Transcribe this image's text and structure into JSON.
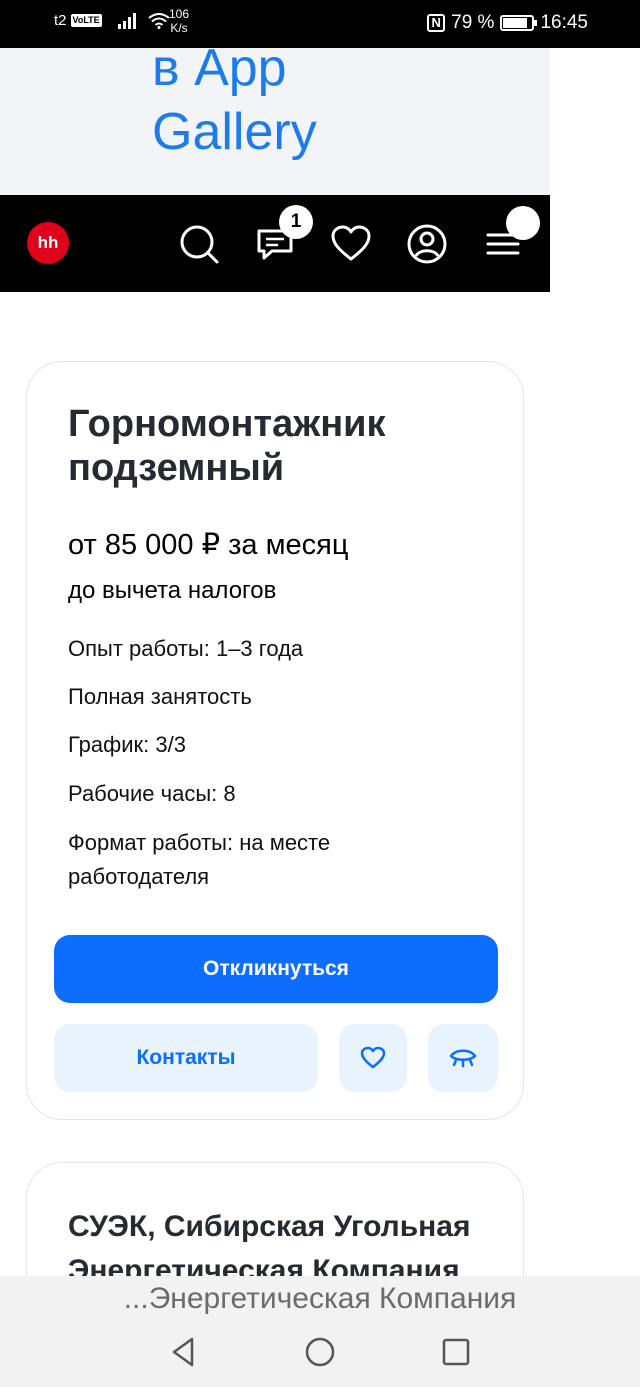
{
  "status_bar": {
    "carrier": "t2",
    "volte": "VoLTE",
    "net_speed": "106",
    "net_speed_unit": "K/s",
    "battery_percent": "79 %",
    "battery_level": 0.79,
    "time": "16:45"
  },
  "banner": {
    "line1": "в App",
    "line2": "Gallery"
  },
  "navbar": {
    "logo": "hh",
    "messages_badge": "1",
    "icons": [
      "search-icon",
      "chat-icon",
      "heart-icon",
      "profile-icon",
      "menu-icon"
    ]
  },
  "vacancy": {
    "title": "Горномонтажник подземный",
    "salary": "от 85 000 ₽ за месяц",
    "salary_note": "до вычета налогов",
    "details": [
      "Опыт работы: 1–3 года",
      "Полная занятость",
      "График: 3/3",
      "Рабочие часы: 8",
      "Формат работы: на месте работодателя"
    ],
    "apply_label": "Откликнуться",
    "contacts_label": "Контакты"
  },
  "employer": {
    "name": "СУЭК, Сибирская Угольная Энергетическая Компания"
  },
  "system_nav": {
    "page_title": "...Энергетическая Компания"
  },
  "colors": {
    "accent": "#0d6efd",
    "accent_light": "#e8f3fe",
    "hh_red": "#e3001b",
    "banner_text": "#1d7cec"
  }
}
